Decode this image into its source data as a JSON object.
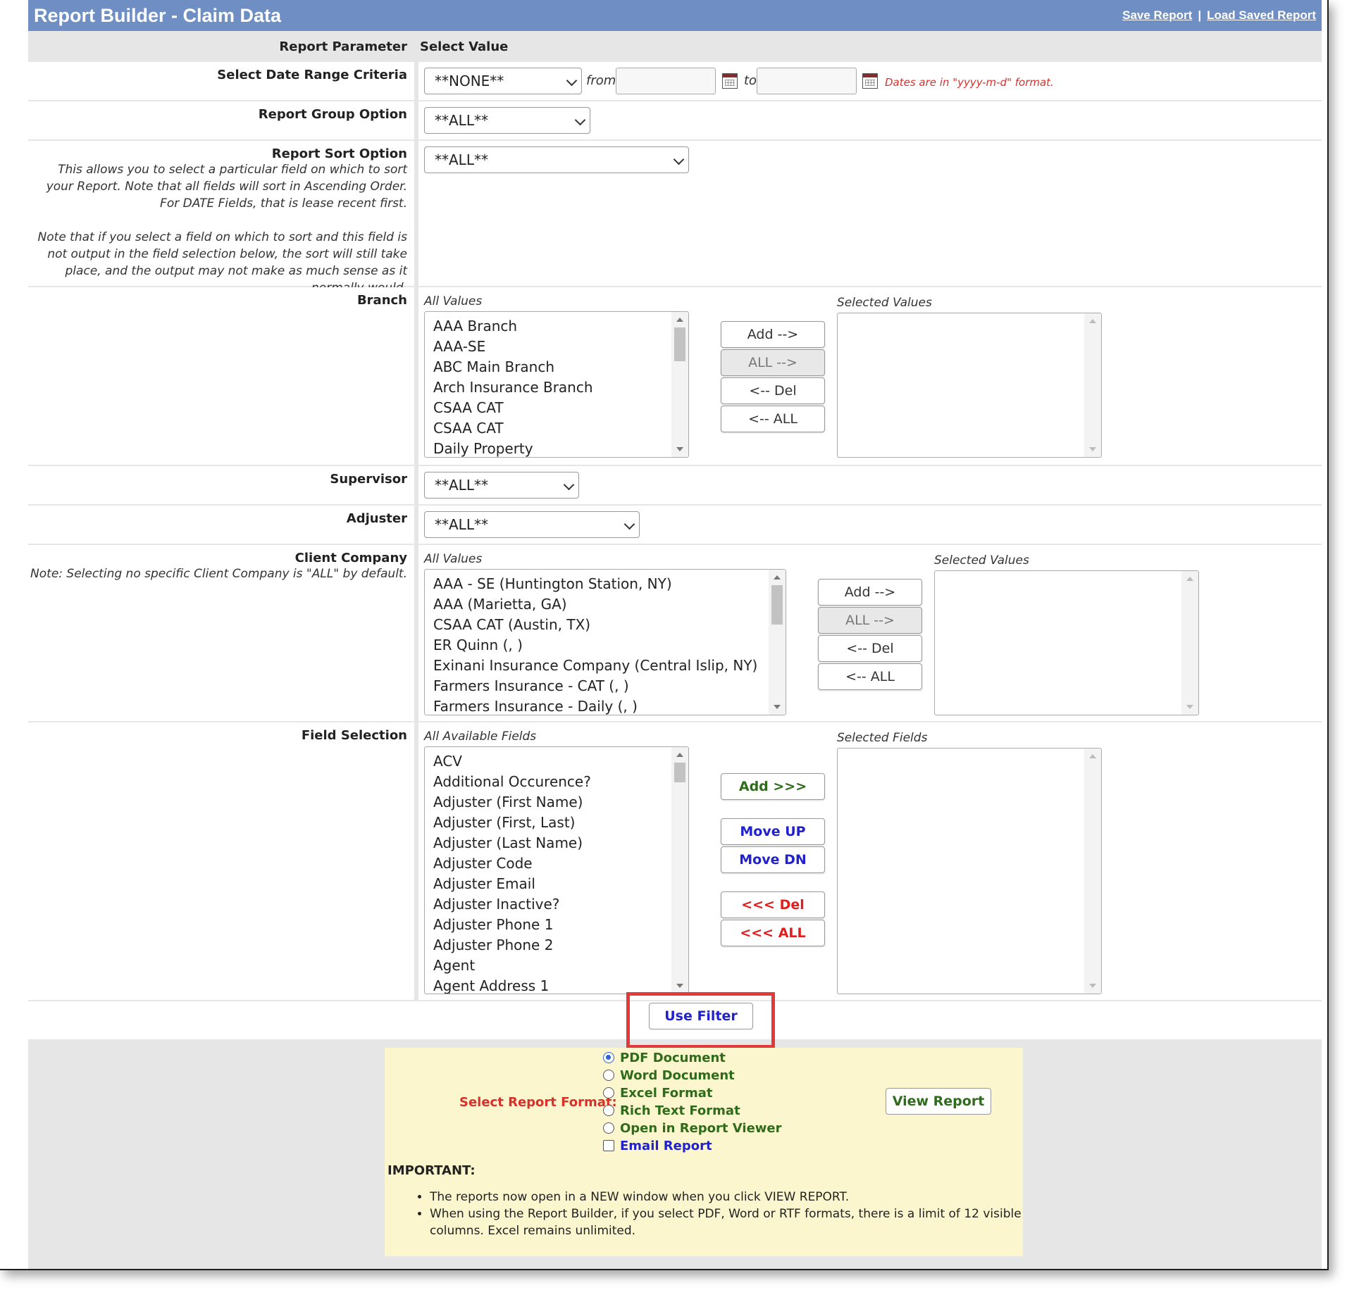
{
  "header": {
    "title": "Report Builder - Claim Data",
    "save_report": "Save Report",
    "separator": "|",
    "load_saved_report": "Load Saved Report"
  },
  "table_header": {
    "param": "Report Parameter",
    "value": "Select Value"
  },
  "date_range": {
    "label": "Select Date Range Criteria",
    "selected": "**NONE**",
    "from": "from",
    "to": "to",
    "from_value": "",
    "to_value": "",
    "format_note": "Dates are in \"yyyy-m-d\" format."
  },
  "group_option": {
    "label": "Report Group Option",
    "selected": "**ALL**"
  },
  "sort_option": {
    "label": "Report Sort Option",
    "selected": "**ALL**",
    "note1": "This allows you to select a particular field on which to sort your Report. Note that all fields will sort in Ascending Order. For DATE Fields, that is lease recent first.",
    "note2": "Note that if you select a field on which to sort and this field is not output in the field selection below, the sort will still take place, and the output may not make as much sense as it normally would."
  },
  "branch": {
    "label": "Branch",
    "all_caption": "All Values",
    "selected_caption": "Selected Values",
    "items": [
      "AAA Branch",
      "AAA-SE",
      "ABC Main Branch",
      "Arch Insurance Branch",
      "CSAA CAT",
      "CSAA CAT",
      "Daily Property"
    ],
    "buttons": {
      "add": "Add -->",
      "all": "ALL -->",
      "del": "<-- Del",
      "del_all": "<-- ALL"
    }
  },
  "supervisor": {
    "label": "Supervisor",
    "selected": "**ALL**"
  },
  "adjuster": {
    "label": "Adjuster",
    "selected": "**ALL**"
  },
  "client_company": {
    "label": "Client Company",
    "note": "Note: Selecting no specific Client Company is \"ALL\" by default.",
    "all_caption": "All Values",
    "selected_caption": "Selected Values",
    "items": [
      "AAA - SE (Huntington Station, NY)",
      "AAA (Marietta, GA)",
      "CSAA CAT (Austin, TX)",
      "ER Quinn (, )",
      "Exinani Insurance Company (Central Islip, NY)",
      "Farmers Insurance - CAT (, )",
      "Farmers Insurance - Daily (, )"
    ],
    "buttons": {
      "add": "Add -->",
      "all": "ALL -->",
      "del": "<-- Del",
      "del_all": "<-- ALL"
    }
  },
  "field_selection": {
    "label": "Field Selection",
    "all_caption": "All Available Fields",
    "selected_caption": "Selected Fields",
    "items": [
      "ACV",
      "Additional Occurence?",
      "Adjuster (First Name)",
      "Adjuster (First, Last)",
      "Adjuster (Last Name)",
      "Adjuster Code",
      "Adjuster Email",
      "Adjuster Inactive?",
      "Adjuster Phone 1",
      "Adjuster Phone 2",
      "Agent",
      "Agent Address 1"
    ],
    "buttons": {
      "add": "Add >>>",
      "move_up": "Move UP",
      "move_dn": "Move DN",
      "del": "<<< Del",
      "del_all": "<<< ALL"
    }
  },
  "use_filter": "Use Filter",
  "report_format": {
    "label": "Select Report Format:",
    "options": [
      "PDF Document",
      "Word Document",
      "Excel Format",
      "Rich Text Format",
      "Open in Report Viewer"
    ],
    "selected_index": 0,
    "email": "Email Report",
    "email_checked": false,
    "view_button": "View Report",
    "important": "IMPORTANT:",
    "bullets": [
      "The reports now open in a NEW window when you click VIEW REPORT.",
      "When using the Report Builder, if you select PDF, Word or RTF formats, there is a limit of 12 visible columns. Excel remains unlimited."
    ]
  },
  "colors": {
    "title_bar": "#6f8fc4",
    "highlight": "#e03a3a",
    "green_text": "#2e6b1a",
    "blue_text": "#2222cc",
    "red_text": "#e01e1e",
    "panel_bg": "#fbf6cd"
  }
}
